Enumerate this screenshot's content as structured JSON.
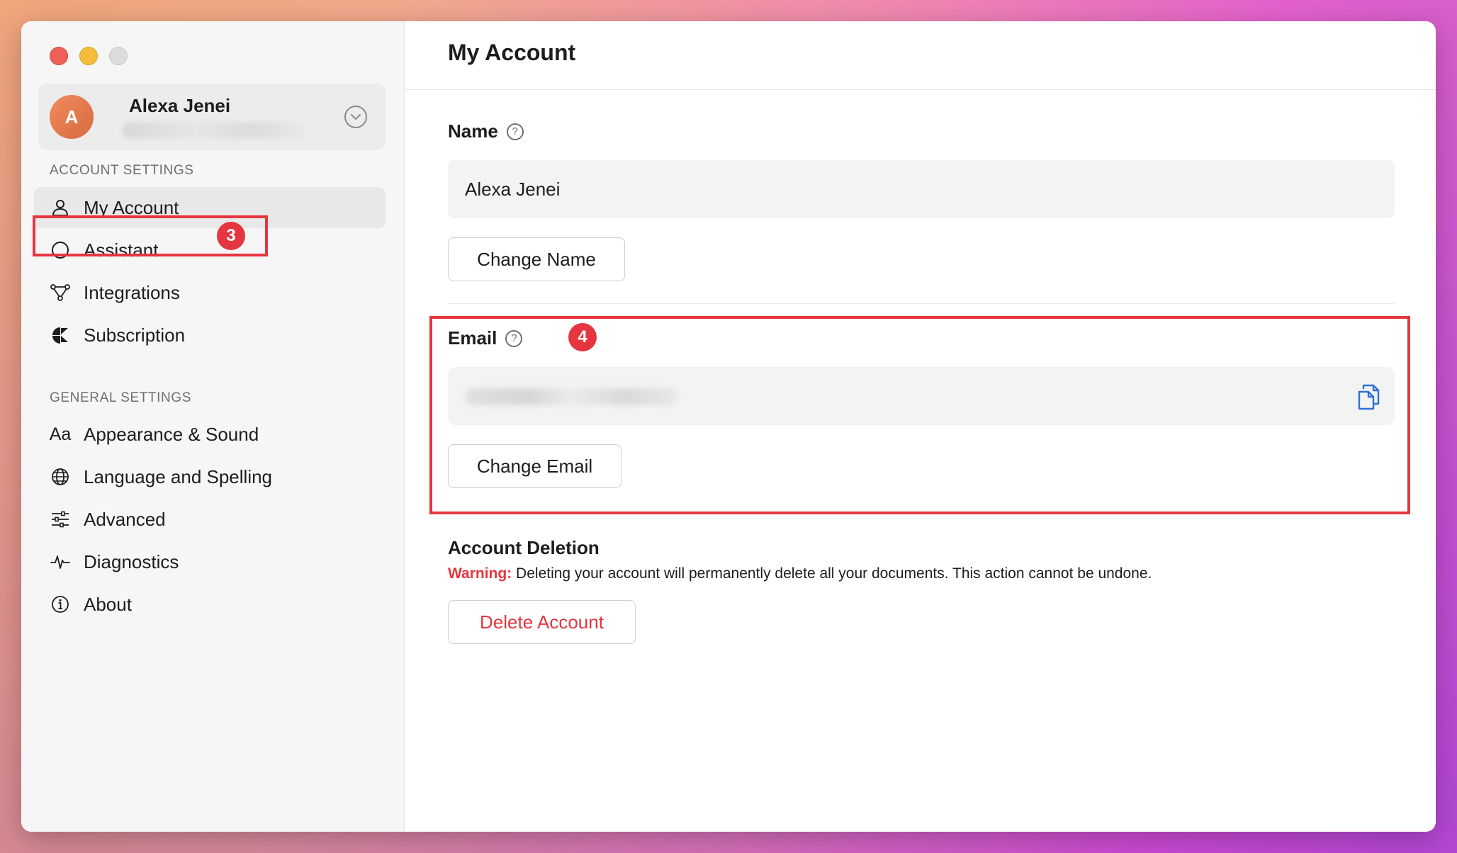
{
  "sidebar": {
    "account": {
      "initial": "A",
      "name": "Alexa Jenei"
    },
    "account_settings_label": "ACCOUNT SETTINGS",
    "account_items": [
      {
        "label": "My Account",
        "icon": "person-icon"
      },
      {
        "label": "Assistant",
        "icon": "circle-icon"
      },
      {
        "label": "Integrations",
        "icon": "integrations-icon"
      },
      {
        "label": "Subscription",
        "icon": "subscription-icon"
      }
    ],
    "general_settings_label": "GENERAL SETTINGS",
    "general_items": [
      {
        "label": "Appearance & Sound",
        "icon": "text-aa-icon",
        "glyph": "Aa"
      },
      {
        "label": "Language and Spelling",
        "icon": "globe-icon"
      },
      {
        "label": "Advanced",
        "icon": "sliders-icon"
      },
      {
        "label": "Diagnostics",
        "icon": "pulse-icon"
      },
      {
        "label": "About",
        "icon": "info-icon"
      }
    ]
  },
  "main": {
    "title": "My Account",
    "name_section": {
      "label": "Name",
      "help_glyph": "?",
      "value": "Alexa Jenei",
      "button": "Change Name"
    },
    "email_section": {
      "label": "Email",
      "help_glyph": "?",
      "button": "Change Email"
    },
    "deletion_section": {
      "title": "Account Deletion",
      "warning_label": "Warning:",
      "warning_text": " Deleting your account will permanently delete all your documents. This action cannot be undone.",
      "button": "Delete Account"
    }
  },
  "annotations": {
    "step_3": "3",
    "step_4": "4"
  },
  "colors": {
    "accent_red": "#e5363f",
    "avatar": "#e0734a",
    "sidebar_bg": "#f6f6f6",
    "selected_bg": "#e8e8e8",
    "field_bg": "#f3f3f3",
    "copy_icon": "#2f6fd6"
  }
}
